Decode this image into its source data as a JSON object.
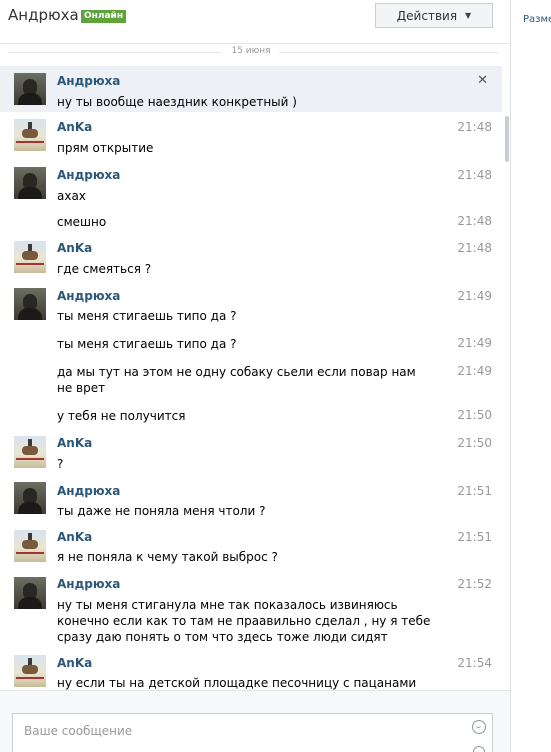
{
  "header": {
    "contact_name": "Андрюха",
    "status_badge": "Онлайн",
    "actions_label": "Действия"
  },
  "right_panel": {
    "peek_text": "Разме"
  },
  "date_separator": "15 июня",
  "messages": [
    {
      "author": "Андрюха",
      "time": "",
      "text": "ну ты вообще наездник конкретный )",
      "avatar": "andryukha-avatar"
    },
    {
      "author": "AnKa",
      "time": "21:48",
      "text": "прям открытие",
      "avatar": "anka-avatar"
    },
    {
      "author": "Андрюха",
      "time": "21:48",
      "text": "ахах",
      "avatar": "andryukha-avatar"
    },
    {
      "author": "",
      "time": "21:48",
      "text": "смешно"
    },
    {
      "author": "AnKa",
      "time": "21:48",
      "text": "где смеяться ?",
      "avatar": "anka-avatar"
    },
    {
      "author": "Андрюха",
      "time": "21:49",
      "text": "ты меня стигаешь типо да ?",
      "avatar": "andryukha-avatar"
    },
    {
      "author": "",
      "time": "21:49",
      "text": "ты меня стигаешь типо да ?"
    },
    {
      "author": "",
      "time": "21:49",
      "text": "да мы тут на этом не одну собаку сьели если повар нам не врет"
    },
    {
      "author": "",
      "time": "21:50",
      "text": "у тебя не получится"
    },
    {
      "author": "AnKa",
      "time": "21:50",
      "text": "?",
      "avatar": "anka-avatar"
    },
    {
      "author": "Андрюха",
      "time": "21:51",
      "text": "ты даже не поняла меня чтоли ?",
      "avatar": "andryukha-avatar"
    },
    {
      "author": "AnKa",
      "time": "21:51",
      "text": "я не поняла к чему такой выброс ?",
      "avatar": "anka-avatar"
    },
    {
      "author": "Андрюха",
      "time": "21:52",
      "text": "ну ты меня стиганула мне так показалось извиняюсь конечно если как то там не праавильно сделал , ну я тебе сразу даю понять о том что здесь тоже люди сидят",
      "avatar": "andryukha-avatar"
    },
    {
      "author": "AnKa",
      "time": "21:54",
      "text": "ну если ты на детской площадке песочницу с пацанами",
      "avatar": "anka-avatar"
    }
  ],
  "composer": {
    "placeholder": "Ваше сообщение"
  }
}
